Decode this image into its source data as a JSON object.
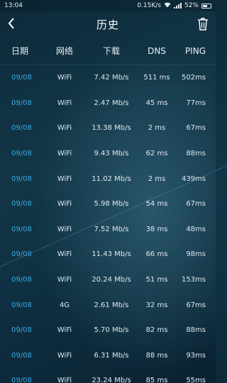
{
  "status": {
    "time": "13:04",
    "speed": "0.15K/s",
    "battery": "52%"
  },
  "app": {
    "title": "历史",
    "back_icon": "chevron-left-icon",
    "delete_icon": "trash-icon"
  },
  "columns": {
    "date": "日期",
    "network": "网络",
    "download": "下载",
    "dns": "DNS",
    "ping": "PING"
  },
  "rows": [
    {
      "date": "09/08",
      "network": "WiFi",
      "download": "7.42 Mb/s",
      "dns": "511 ms",
      "ping": "502ms"
    },
    {
      "date": "09/08",
      "network": "WiFi",
      "download": "2.47 Mb/s",
      "dns": "45 ms",
      "ping": "77ms"
    },
    {
      "date": "09/08",
      "network": "WiFi",
      "download": "13.38 Mb/s",
      "dns": "2 ms",
      "ping": "67ms"
    },
    {
      "date": "09/08",
      "network": "WiFi",
      "download": "9.43 Mb/s",
      "dns": "62 ms",
      "ping": "88ms"
    },
    {
      "date": "09/08",
      "network": "WiFi",
      "download": "11.02 Mb/s",
      "dns": "2 ms",
      "ping": "439ms"
    },
    {
      "date": "09/08",
      "network": "WiFi",
      "download": "5.98 Mb/s",
      "dns": "54 ms",
      "ping": "67ms"
    },
    {
      "date": "09/08",
      "network": "WiFi",
      "download": "7.52 Mb/s",
      "dns": "38 ms",
      "ping": "48ms"
    },
    {
      "date": "09/08",
      "network": "WiFi",
      "download": "11.43 Mb/s",
      "dns": "66 ms",
      "ping": "98ms"
    },
    {
      "date": "09/08",
      "network": "WiFi",
      "download": "20.24 Mb/s",
      "dns": "51 ms",
      "ping": "153ms"
    },
    {
      "date": "09/08",
      "network": "4G",
      "download": "2.61 Mb/s",
      "dns": "32 ms",
      "ping": "67ms"
    },
    {
      "date": "09/08",
      "network": "WiFi",
      "download": "5.70 Mb/s",
      "dns": "82 ms",
      "ping": "88ms"
    },
    {
      "date": "09/08",
      "network": "WiFi",
      "download": "6.31 Mb/s",
      "dns": "88 ms",
      "ping": "93ms"
    },
    {
      "date": "09/08",
      "network": "WiFi",
      "download": "23.24 Mb/s",
      "dns": "85 ms",
      "ping": "55ms"
    }
  ],
  "colors": {
    "date_accent": "#3aa7e0",
    "background_top": "#0d2a3a",
    "text": "#dfe8ee"
  }
}
